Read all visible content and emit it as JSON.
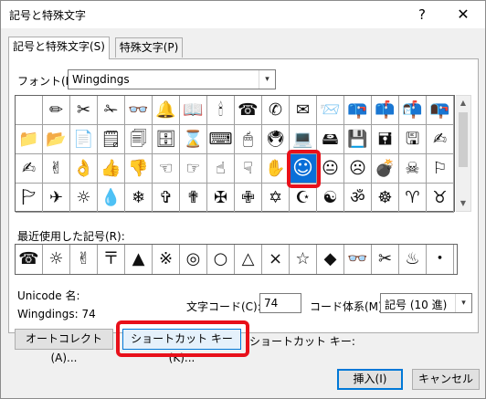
{
  "window": {
    "title": "記号と特殊文字",
    "help_glyph": "?",
    "close_glyph": "✕"
  },
  "tabs": [
    {
      "label": "記号と特殊文字(S)",
      "active": true
    },
    {
      "label": "特殊文字(P)",
      "active": false
    }
  ],
  "font": {
    "label": "フォント(F):",
    "value": "Wingdings",
    "arrow": "▾"
  },
  "grid": {
    "rows": [
      [
        " ",
        "✏",
        "✂",
        "✁",
        "👓",
        "🔔",
        "📖",
        "🕯",
        "☎",
        "✆",
        "✉",
        "📨",
        "📪",
        "📫",
        "📬",
        "📭"
      ],
      [
        "📁",
        "📂",
        "📄",
        "🗒",
        "🗐",
        "🗄",
        "⌛",
        "⌨",
        "🖱",
        "🖲",
        "💻",
        "🖴",
        "💾",
        "🖬",
        "🖫",
        "✍"
      ],
      [
        "✍",
        "✌",
        "👌",
        "👍",
        "👎",
        "☜",
        "☞",
        "☝",
        "☟",
        "✋",
        "☺",
        "😐",
        "☹",
        "💣",
        "☠",
        "⚐"
      ],
      [
        "🏱",
        "✈",
        "☼",
        "💧",
        "❄",
        "✞",
        "✟",
        "✠",
        "✙",
        "✡",
        "☪",
        "☯",
        "ॐ",
        "☸",
        "♈",
        "♉"
      ]
    ],
    "selected_row": 2,
    "selected_col": 10,
    "scroll_up": "▲",
    "scroll_down": "▼"
  },
  "recent": {
    "label": "最近使用した記号(R):",
    "items": [
      "☎",
      "☼",
      "✌",
      "〒",
      "▲",
      "※",
      "◎",
      "○",
      "△",
      "×",
      "☆",
      "◆",
      "👓",
      "✂",
      "♨",
      "・"
    ]
  },
  "unicode": {
    "label": "Unicode 名:",
    "name": "Wingdings: 74"
  },
  "char_code": {
    "label": "文字コード(C):",
    "value": "74"
  },
  "system": {
    "label": "コード体系(M):",
    "value": "記号 (10 進)",
    "arrow": "▾"
  },
  "buttons": {
    "autocorrect": "オートコレクト(A)...",
    "shortcut_key": "ショートカット キー(K)...",
    "insert": "挿入(I)",
    "cancel": "キャンセル"
  },
  "shortcut_key_label": "ショートカット キー:",
  "highlight_color": "#e8101a",
  "selection_color": "#0a6fd8"
}
